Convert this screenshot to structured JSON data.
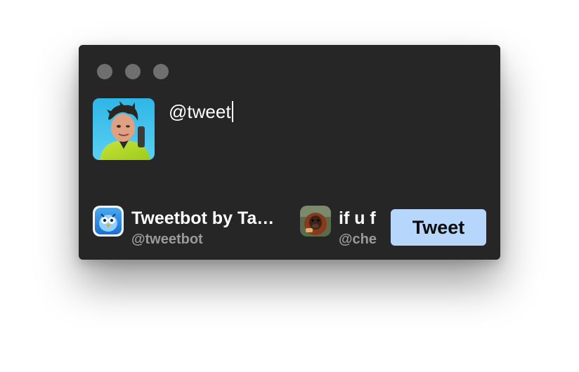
{
  "window": {
    "controls": [
      "close",
      "minimize",
      "zoom"
    ]
  },
  "compose": {
    "text": "@tweet",
    "avatar_icon": "user-avatar-photo"
  },
  "suggestions": [
    {
      "name": "Tweetbot by Ta…",
      "handle": "@tweetbot",
      "icon": "tweetbot-app-icon"
    },
    {
      "name": "if u f",
      "handle": "@che",
      "icon": "orangutan-avatar"
    }
  ],
  "actions": {
    "tweet_label": "Tweet"
  },
  "colors": {
    "window_bg": "#262626",
    "button_bg": "#b7d6fb",
    "handle_text": "#9a9a9a",
    "traffic_light": "#6f6f6f"
  }
}
